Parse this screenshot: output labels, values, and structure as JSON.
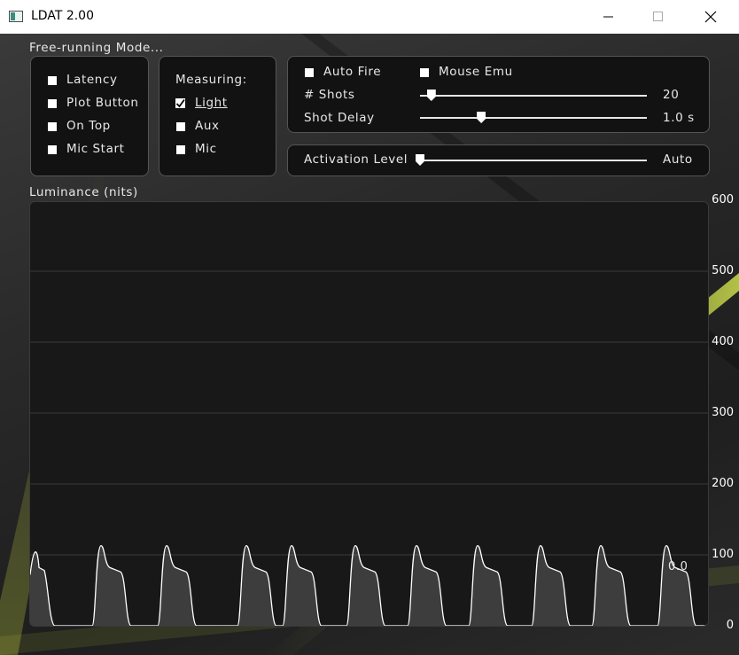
{
  "window": {
    "title": "LDAT 2.00",
    "minimize_glyph": "—",
    "maximize_glyph": "☐",
    "close_glyph": "✕"
  },
  "mode": {
    "label": "Free-running  Mode..."
  },
  "options": {
    "latency": "Latency",
    "plot_button": "Plot  Button",
    "on_top": "On  Top",
    "mic_start": "Mic  Start"
  },
  "measuring": {
    "heading": "Measuring:",
    "light": "Light",
    "light_checked": true,
    "aux": "Aux",
    "mic": "Mic"
  },
  "controls": {
    "auto_fire": "Auto  Fire",
    "mouse_emu": "Mouse  Emu",
    "shots_label": "#  Shots",
    "shots_value": "20",
    "shots_level": 0.05,
    "shot_delay_label": "Shot  Delay",
    "shot_delay_value": "1.0  s",
    "shot_delay_level": 0.27,
    "activation_label": "Activation  Level",
    "activation_value": "Auto",
    "activation_level": 0.0
  },
  "chart_data": {
    "type": "line",
    "title": "Luminance  (nits)",
    "ylim": [
      0,
      600
    ],
    "y_ticks": [
      "600",
      "500",
      "400",
      "300",
      "200",
      "100",
      "0"
    ],
    "grid": true,
    "cursor_readout": "0.0",
    "series": [
      {
        "pulses": 12,
        "peak": 113,
        "plateau": 82,
        "baseline": 0
      }
    ]
  },
  "colors": {
    "accent": "#c8d840",
    "panel_bg": "#121212",
    "text": "#e8e8e8"
  }
}
